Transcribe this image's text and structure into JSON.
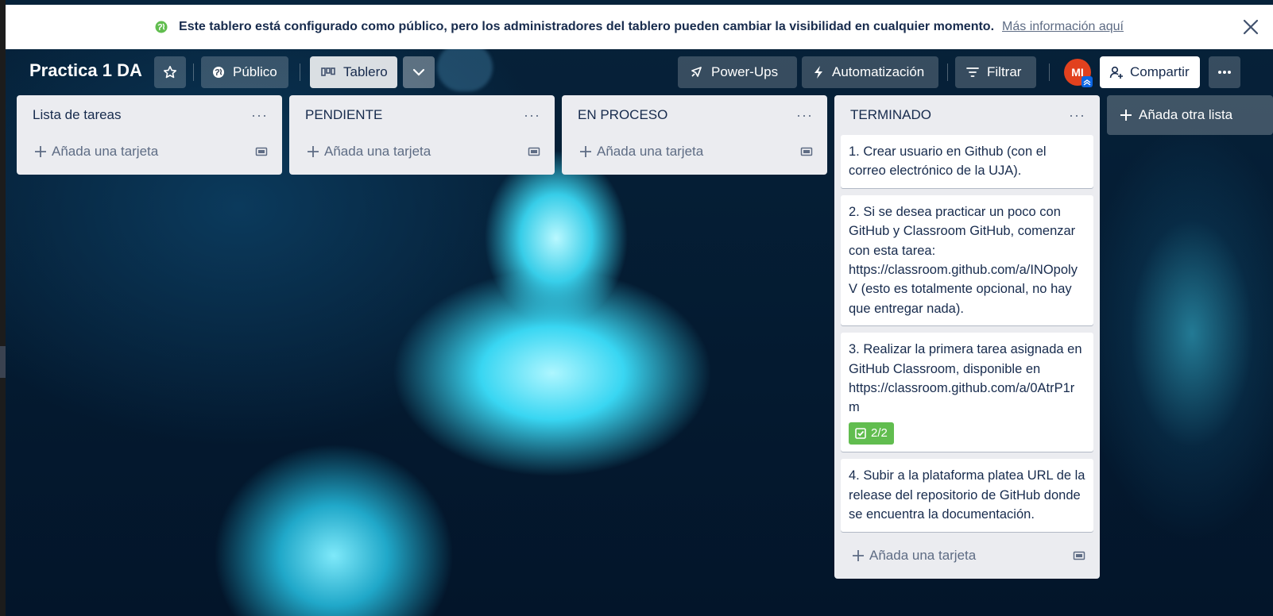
{
  "banner": {
    "message": "Este tablero está configurado como público, pero los administradores del tablero pueden cambiar la visibilidad en cualquier momento.",
    "link": "Más información aquí",
    "icon": "globe-icon",
    "icon_color": "#61bd4f"
  },
  "header": {
    "board_title": "Practica 1 DA",
    "visibility_label": "Público",
    "view_label": "Tablero",
    "powerups_label": "Power-Ups",
    "automation_label": "Automatización",
    "filter_label": "Filtrar",
    "avatar_initials": "MI",
    "share_label": "Compartir"
  },
  "lists": [
    {
      "title": "Lista de tareas",
      "cards": [],
      "add_card_label": "Añada una tarjeta"
    },
    {
      "title": "PENDIENTE",
      "cards": [],
      "add_card_label": "Añada una tarjeta"
    },
    {
      "title": "EN PROCESO",
      "cards": [],
      "add_card_label": "Añada una tarjeta"
    },
    {
      "title": "TERMINADO",
      "cards": [
        {
          "text": "1. Crear usuario en Github (con el correo electrónico de la UJA)."
        },
        {
          "text": "2. Si se desea practicar un poco con GitHub y Classroom GitHub, comenzar con esta tarea: https://classroom.github.com/a/INOpolyV (esto es totalmente opcional, no hay que entregar nada)."
        },
        {
          "text": "3. Realizar la primera tarea asignada en GitHub Classroom, disponible en https://classroom.github.com/a/0AtrP1rm",
          "checklist": "2/2"
        },
        {
          "text": "4. Subir a la plataforma platea URL de la release del repositorio de GitHub donde se encuentra la documentación."
        }
      ],
      "add_card_label": "Añada una tarjeta"
    }
  ],
  "add_list_label": "Añada otra lista",
  "colors": {
    "list_bg": "#ebecf0",
    "checklist_complete": "#61bd4f",
    "avatar": "#e2411e"
  }
}
